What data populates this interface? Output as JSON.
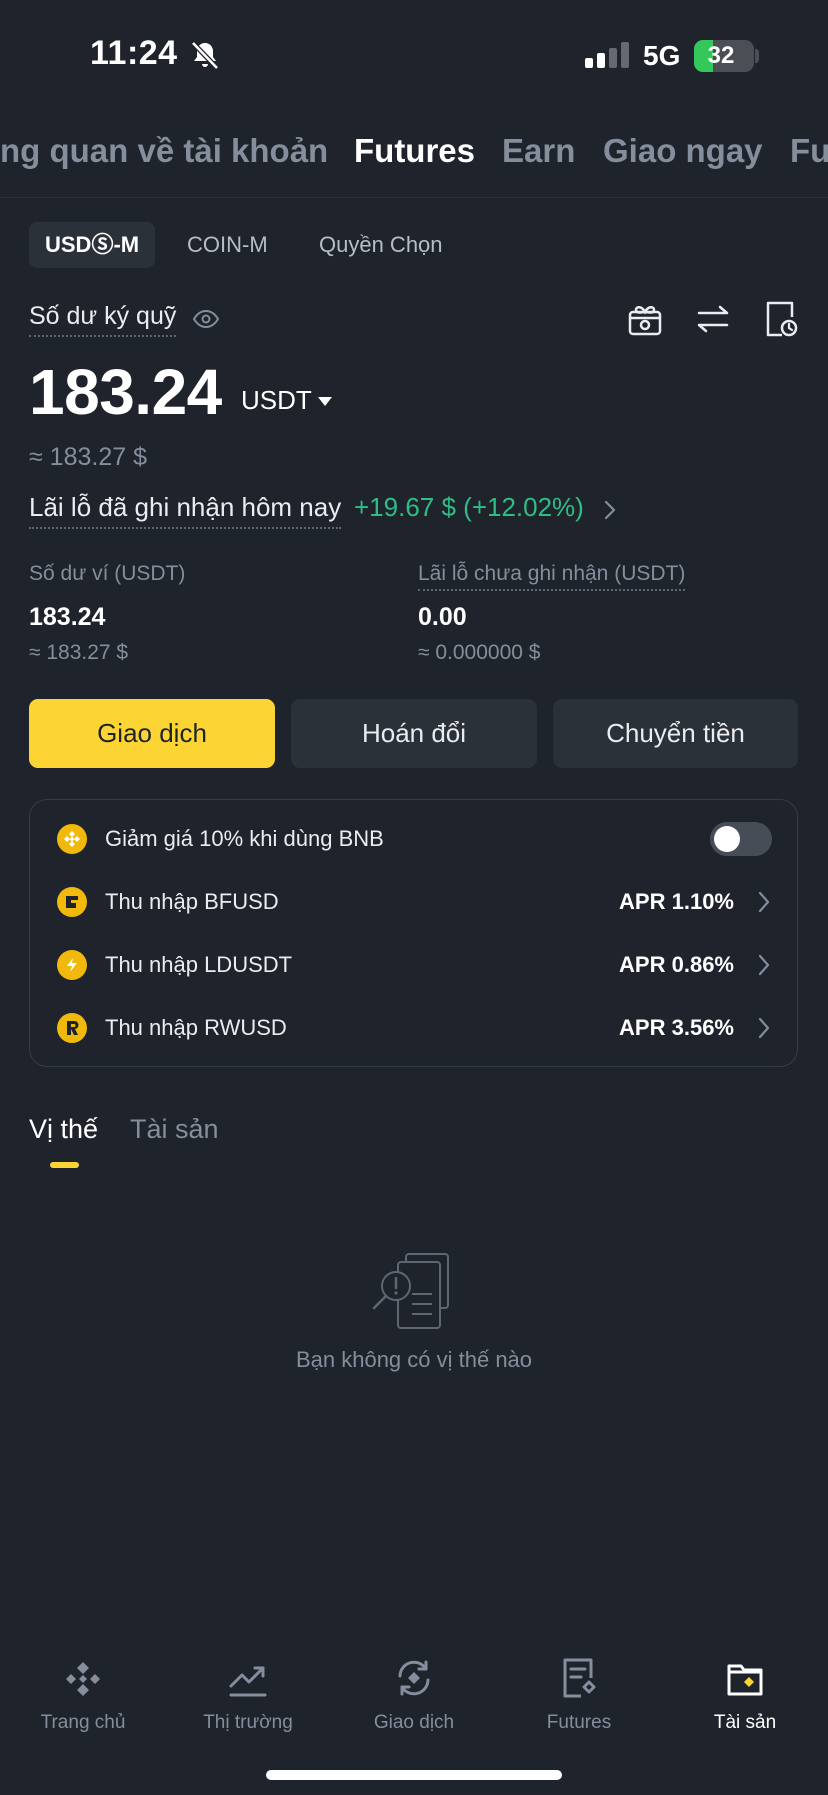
{
  "status": {
    "time": "11:24",
    "network": "5G",
    "battery": "32"
  },
  "top_tabs": [
    "ng quan về tài khoản",
    "Futures",
    "Earn",
    "Giao ngay",
    "Fu"
  ],
  "sub_tabs": [
    "USDⓈ-M",
    "COIN-M",
    "Quyền Chọn"
  ],
  "margin": {
    "label": "Số dư ký quỹ",
    "value": "183.24",
    "unit": "USDT",
    "approx": "≈ 183.27 $"
  },
  "pnl": {
    "label": "Lãi lỗ đã ghi nhận hôm nay",
    "value": "+19.67 $ (+12.02%)"
  },
  "wallet": {
    "label": "Số dư ví (USDT)",
    "value": "183.24",
    "approx": "≈ 183.27 $"
  },
  "unrealized": {
    "label": "Lãi lỗ chưa ghi nhận (USDT)",
    "value": "0.00",
    "approx": "≈ 0.000000 $"
  },
  "actions": [
    "Giao dịch",
    "Hoán đổi",
    "Chuyển tiền"
  ],
  "card": {
    "bnb_discount": "Giảm giá 10% khi dùng BNB",
    "toggle_on": false,
    "earn_rows": [
      {
        "label": "Thu nhập BFUSD",
        "apr": "APR 1.10%"
      },
      {
        "label": "Thu nhập LDUSDT",
        "apr": "APR 0.86%"
      },
      {
        "label": "Thu nhập RWUSD",
        "apr": "APR 3.56%"
      }
    ]
  },
  "position_tabs": [
    "Vị thế",
    "Tài sản"
  ],
  "empty_text": "Bạn không có vị thế nào",
  "bottom_nav": [
    "Trang chủ",
    "Thị trường",
    "Giao dịch",
    "Futures",
    "Tài sản"
  ],
  "colors": {
    "accent": "#fcd535",
    "positive": "#2ebd85",
    "background": "#1f232b",
    "coin": "#f0b90b"
  },
  "icons": [
    "bell-mute-icon",
    "eye-icon",
    "gift-icon",
    "transfer-icon",
    "history-icon",
    "chevron-right-icon",
    "bnb-coin-icon",
    "bfusd-coin-icon",
    "ldusdt-coin-icon",
    "rwusd-coin-icon",
    "empty-document-icon",
    "home-icon",
    "market-icon",
    "trade-icon",
    "futures-icon",
    "assets-icon"
  ]
}
